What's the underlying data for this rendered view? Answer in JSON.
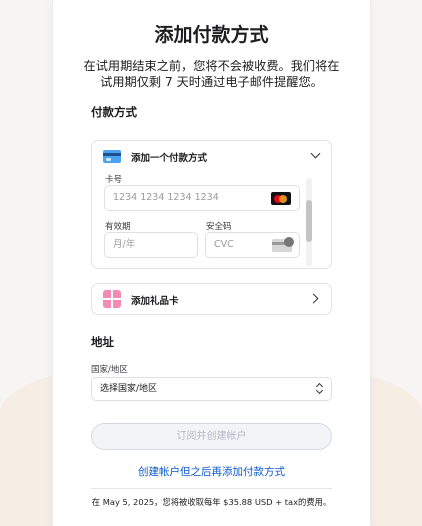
{
  "title": "添加付款方式",
  "subtitle": "在试用期结束之前，您将不会被收费。我们将在试用期仅剩 7 天时通过电子邮件提醒您。",
  "payment_section": {
    "label": "付款方式",
    "add_method_label": "添加一个付款方式",
    "card_number_label": "卡号",
    "card_number_placeholder": "1234 1234 1234 1234",
    "expiry_label": "有效期",
    "expiry_placeholder": "月/年",
    "cvc_label": "安全码",
    "cvc_placeholder": "CVC",
    "gift_card_label": "添加礼品卡"
  },
  "address_section": {
    "label": "地址",
    "country_label": "国家/地区",
    "country_selected": "选择国家/地区"
  },
  "submit_label": "订阅并创建帐户",
  "later_link": "创建帐户但之后再添加付款方式",
  "fine_print": "在 May 5, 2025，您将被收取每年 $35.88 USD + tax的费用。",
  "icons": {
    "card": "credit-card-icon",
    "mastercard": "mastercard-icon",
    "cvc": "cvc-card-icon",
    "gift": "gift-card-icon"
  },
  "colors": {
    "link": "#0a58ca",
    "page_bg": "#f7f5f3",
    "wave": "#f6ede4",
    "disabled_button_bg": "#f3f4f8"
  }
}
